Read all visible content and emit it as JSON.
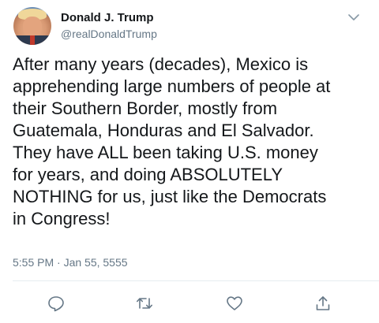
{
  "tweet": {
    "display_name": "Donald J. Trump",
    "handle": "@realDonaldTrump",
    "text": "After many years (decades), Mexico is\napprehending large numbers of people at\ntheir Southern Border, mostly from\nGuatemala, Honduras and El Salvador.\nThey have ALL been taking U.S. money\nfor years, and doing ABSOLUTELY\nNOTHING for us, just like the Democrats\nin Congress!",
    "timestamp": "5:55 PM · Jan 55, 5555"
  },
  "icons": {
    "avatar": "profile-photo",
    "menu": "chevron-down-icon",
    "reply": "reply-icon",
    "retweet": "retweet-icon",
    "like": "heart-icon",
    "share": "share-icon"
  },
  "colors": {
    "text": "#14171a",
    "secondary": "#657786",
    "icon": "#657786",
    "divider": "#e6ecf0"
  }
}
